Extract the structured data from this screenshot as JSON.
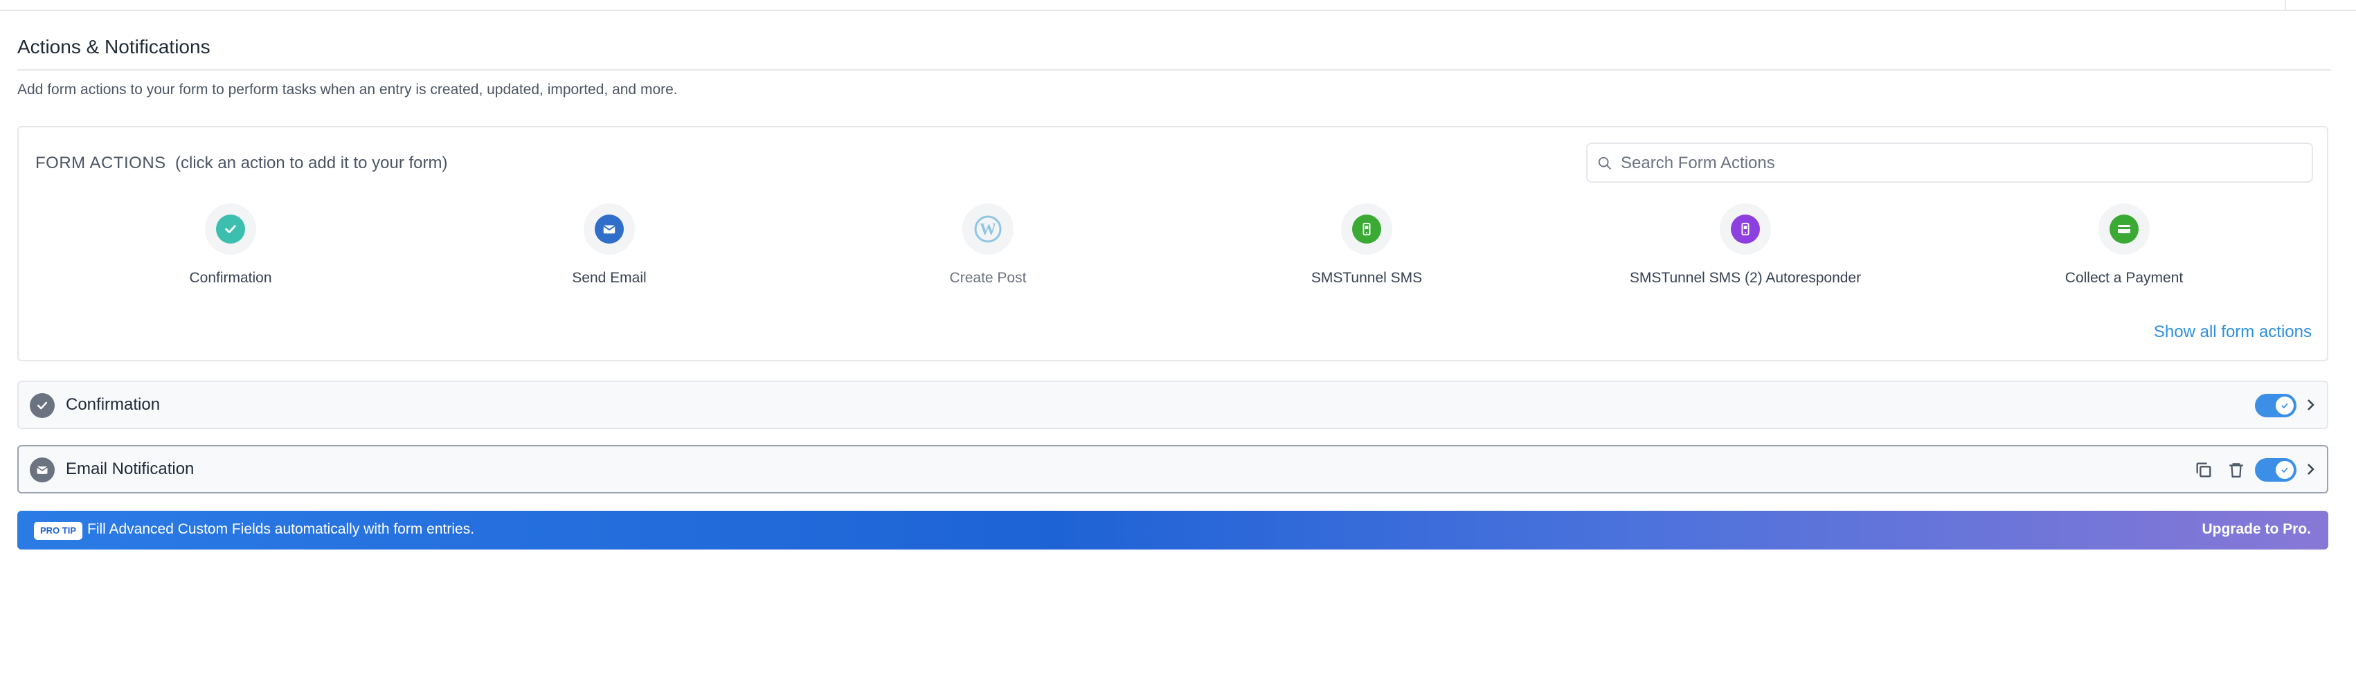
{
  "section": {
    "title": "Actions & Notifications",
    "description": "Add form actions to your form to perform tasks when an entry is created, updated, imported, and more."
  },
  "form_actions": {
    "heading": "FORM ACTIONS",
    "hint": "(click an action to add it to your form)",
    "search_placeholder": "Search Form Actions",
    "items": [
      {
        "label": "Confirmation",
        "icon": "check-icon",
        "color": "#3cbfae"
      },
      {
        "label": "Send Email",
        "icon": "envelope-icon",
        "color": "#2f6fc9"
      },
      {
        "label": "Create Post",
        "icon": "wordpress-icon",
        "color": "#8fc6e3"
      },
      {
        "label": "SMSTunnel SMS",
        "icon": "phone-icon",
        "color": "#3aaa35"
      },
      {
        "label": "SMSTunnel SMS (2) Autoresponder",
        "icon": "phone-icon",
        "color": "#8e3fe0"
      },
      {
        "label": "Collect a Payment",
        "icon": "credit-card-icon",
        "color": "#3aaa35"
      }
    ],
    "show_all_label": "Show all form actions"
  },
  "actions_list": [
    {
      "title": "Confirmation",
      "icon": "check-icon",
      "enabled": true
    },
    {
      "title": "Email Notification",
      "icon": "envelope-icon",
      "enabled": true
    }
  ],
  "protip": {
    "badge": "PRO TIP",
    "text": "Fill Advanced Custom Fields automatically with form entries.",
    "link": "Upgrade to Pro."
  },
  "colors": {
    "accent": "#2d8fe0",
    "toggle_on": "#3b8fe6"
  }
}
